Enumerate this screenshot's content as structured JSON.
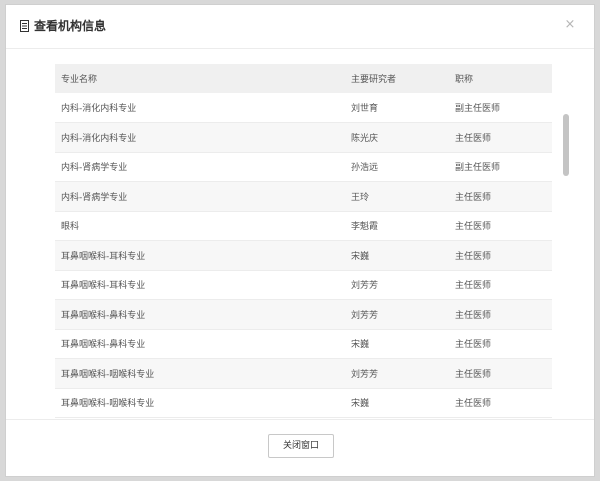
{
  "dialog": {
    "title": "查看机构信息",
    "icon": "document-icon",
    "close_glyph": "×",
    "close_window_label": "关闭窗口"
  },
  "table": {
    "columns": [
      "专业名称",
      "主要研究者",
      "职称"
    ],
    "rows": [
      [
        "内科-消化内科专业",
        "刘世育",
        "副主任医师"
      ],
      [
        "内科-消化内科专业",
        "陈光庆",
        "主任医师"
      ],
      [
        "内科-肾病学专业",
        "孙浩远",
        "副主任医师"
      ],
      [
        "内科-肾病学专业",
        "王玲",
        "主任医师"
      ],
      [
        "眼科",
        "李魁霞",
        "主任医师"
      ],
      [
        "耳鼻咽喉科-耳科专业",
        "宋巍",
        "主任医师"
      ],
      [
        "耳鼻咽喉科-耳科专业",
        "刘芳芳",
        "主任医师"
      ],
      [
        "耳鼻咽喉科-鼻科专业",
        "刘芳芳",
        "主任医师"
      ],
      [
        "耳鼻咽喉科-鼻科专业",
        "宋巍",
        "主任医师"
      ],
      [
        "耳鼻咽喉科-咽喉科专业",
        "刘芳芳",
        "主任医师"
      ],
      [
        "耳鼻咽喉科-咽喉科专业",
        "宋巍",
        "主任医师"
      ]
    ]
  },
  "scrollbar": {
    "position_fraction": 0.17
  }
}
